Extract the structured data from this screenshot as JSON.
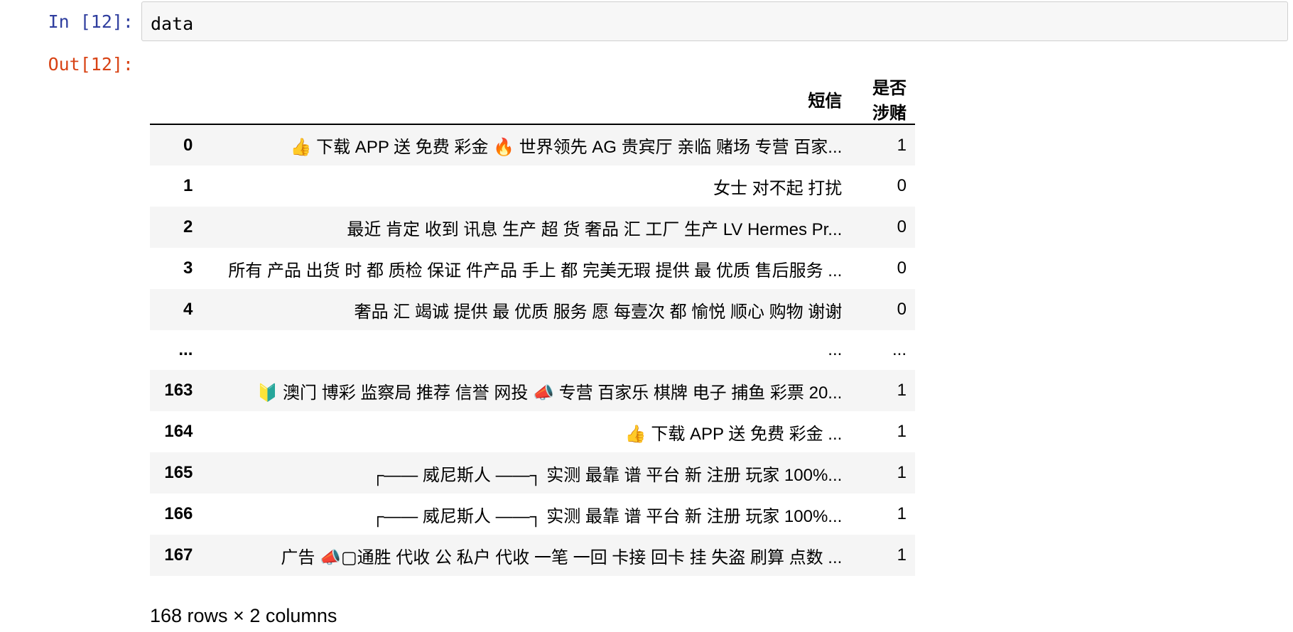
{
  "notebook": {
    "in_prompt": "In [12]:",
    "out_prompt": "Out[12]:",
    "code": "data"
  },
  "dataframe": {
    "columns": [
      "短信",
      "是否涉赌"
    ],
    "rows": [
      {
        "index": "0",
        "msg": "👍 下载 APP 送 免费 彩金 🔥 世界领先 AG 贵宾厅 亲临 赌场 专营 百家...",
        "flag": "1"
      },
      {
        "index": "1",
        "msg": "女士 对不起 打扰",
        "flag": "0"
      },
      {
        "index": "2",
        "msg": "最近 肯定 收到 讯息 生产 超 货 奢品 汇 工厂 生产 LV Hermes Pr...",
        "flag": "0"
      },
      {
        "index": "3",
        "msg": "所有 产品 出货 时 都 质检 保证 件产品 手上 都 完美无瑕 提供 最 优质 售后服务 ...",
        "flag": "0"
      },
      {
        "index": "4",
        "msg": "奢品 汇 竭诚 提供 最 优质 服务 愿 每壹次 都 愉悦 顺心 购物 谢谢",
        "flag": "0"
      },
      {
        "index": "...",
        "msg": "...",
        "flag": "..."
      },
      {
        "index": "163",
        "msg": "🔰 澳门 博彩 监察局 推荐 信誉 网投 📣 专营 百家乐 棋牌 电子 捕鱼 彩票 20...",
        "flag": "1"
      },
      {
        "index": "164",
        "msg": "👍 下载 APP 送 免费 彩金 ...",
        "flag": "1"
      },
      {
        "index": "165",
        "msg": "┌—— 威尼斯人 ——┐ 实测 最靠 谱 平台 新 注册 玩家 100%...",
        "flag": "1"
      },
      {
        "index": "166",
        "msg": "┌—— 威尼斯人 ——┐ 实测 最靠 谱 平台 新 注册 玩家 100%...",
        "flag": "1"
      },
      {
        "index": "167",
        "msg": "广告 📣▢通胜 代收 公 私户 代收 一笔 一回 卡接 回卡 挂 失盗 刷算 点数 ...",
        "flag": "1"
      }
    ],
    "summary": "168 rows × 2 columns"
  }
}
